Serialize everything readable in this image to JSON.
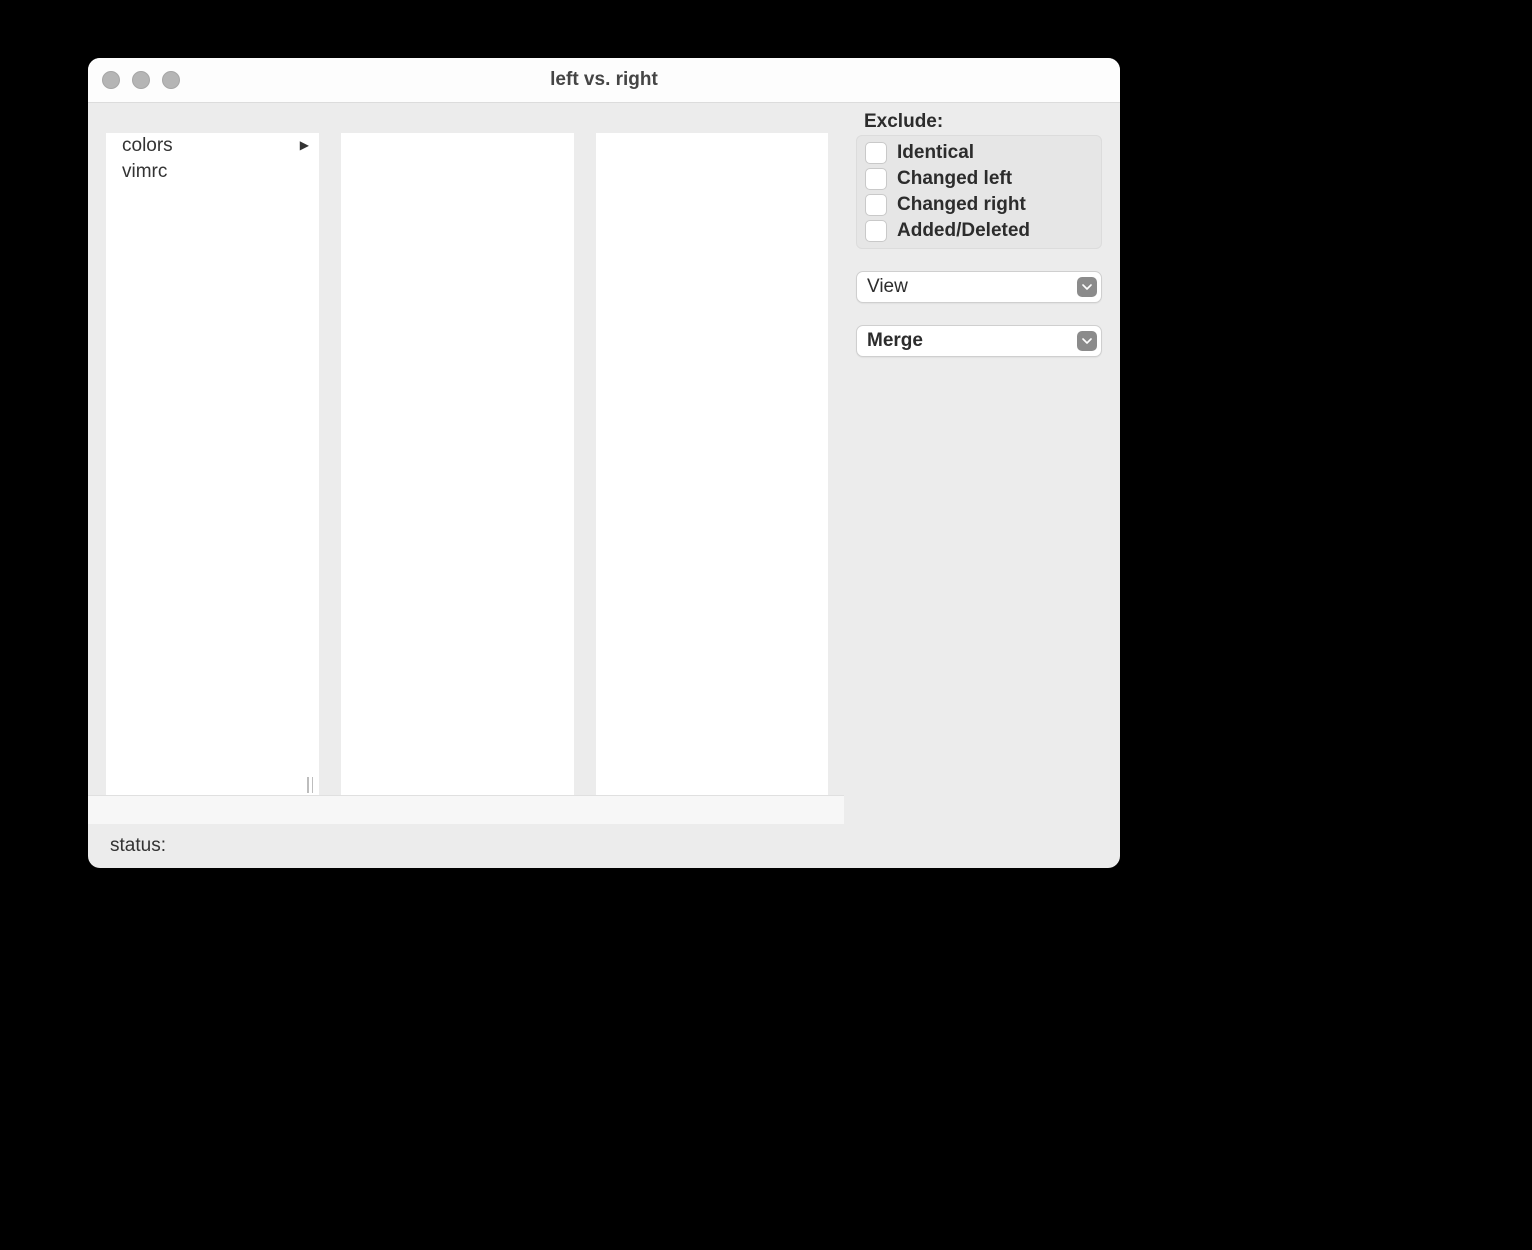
{
  "window": {
    "title": "left vs. right"
  },
  "tree": {
    "items": [
      {
        "label": "colors",
        "expandable": true
      },
      {
        "label": "vimrc",
        "expandable": false
      }
    ]
  },
  "sidebar": {
    "exclude_label": "Exclude:",
    "exclude_options": [
      {
        "label": "Identical",
        "checked": false
      },
      {
        "label": "Changed left",
        "checked": false
      },
      {
        "label": "Changed right",
        "checked": false
      },
      {
        "label": "Added/Deleted",
        "checked": false
      }
    ],
    "view_select": {
      "label": "View"
    },
    "merge_select": {
      "label": "Merge"
    }
  },
  "footer": {
    "status_label": "status:",
    "status_value": ""
  }
}
